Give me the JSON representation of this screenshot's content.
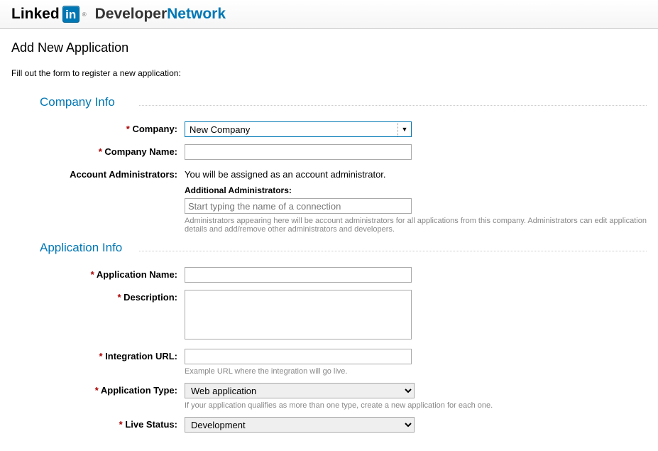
{
  "header": {
    "linked": "Linked",
    "in": "in",
    "reg": "®",
    "developer": "Developer",
    "network": "Network"
  },
  "page": {
    "title": "Add New Application",
    "intro": "Fill out the form to register a new application:"
  },
  "company_info": {
    "section_title": "Company Info",
    "company_label": "Company:",
    "company_value": "New Company",
    "company_name_label": "Company Name:",
    "company_name_value": "",
    "account_admins_label": "Account Administrators:",
    "account_admins_text": "You will be assigned as an account administrator.",
    "additional_admins_label": "Additional Administrators:",
    "additional_admins_placeholder": "Start typing the name of a connection",
    "admins_note": "Administrators appearing here will be account administrators for all applications from this company. Administrators can edit application details and add/remove other administrators and developers."
  },
  "application_info": {
    "section_title": "Application Info",
    "app_name_label": "Application Name:",
    "app_name_value": "",
    "description_label": "Description:",
    "description_value": "",
    "integration_url_label": "Integration URL:",
    "integration_url_value": "",
    "integration_url_note": "Example URL where the integration will go live.",
    "app_type_label": "Application Type:",
    "app_type_value": "Web application",
    "app_type_note": "If your application qualifies as more than one type, create a new application for each one.",
    "live_status_label": "Live Status:",
    "live_status_value": "Development"
  },
  "required_marker": "*"
}
